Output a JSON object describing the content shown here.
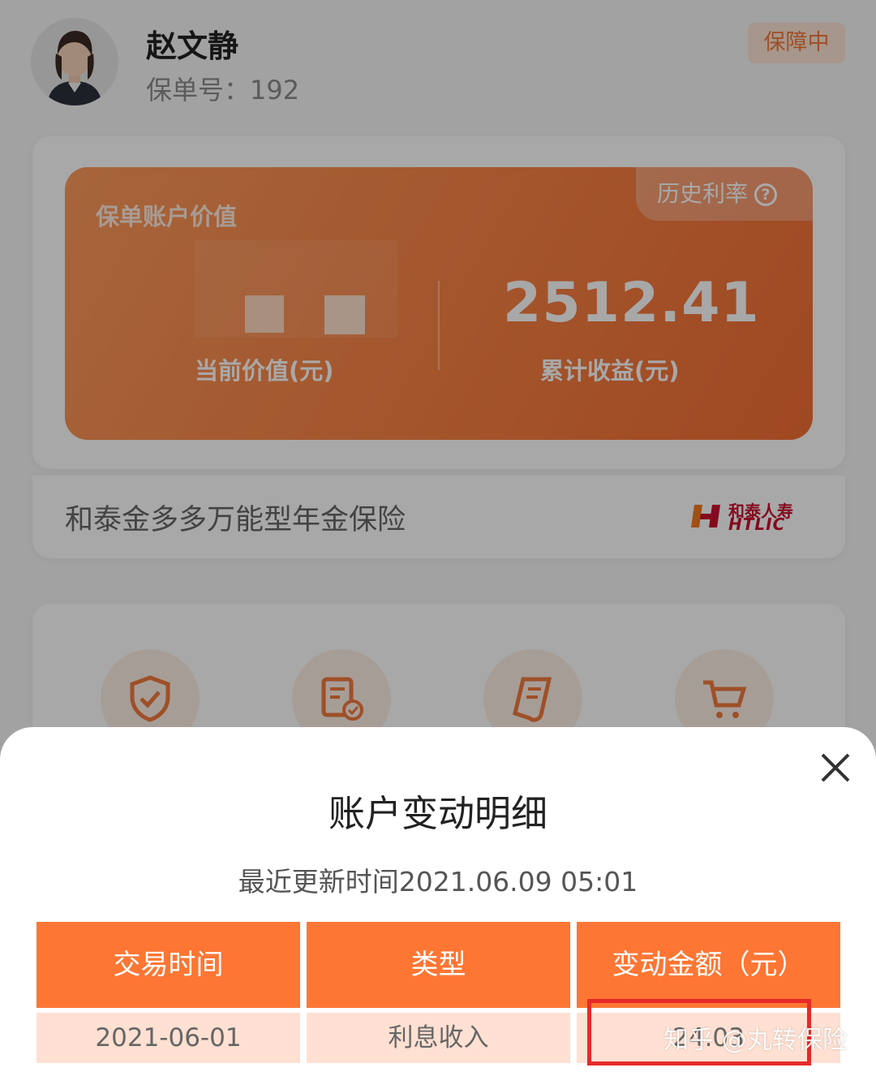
{
  "user": {
    "name": "赵文静",
    "policy_label": "保单号：192",
    "status": "保障中"
  },
  "account_panel": {
    "title": "保单账户价值",
    "history_rate": "历史利率",
    "current_value_label": "当前价值(元)",
    "total_earnings": "2512.41",
    "total_earnings_label": "累计收益(元)"
  },
  "product": {
    "name": "和泰金多多万能型年金保险",
    "company_cn": "和泰人寿",
    "company_en": "HTLIC"
  },
  "sheet": {
    "title": "账户变动明细",
    "update_time": "最近更新时间2021.06.09 05:01",
    "columns": [
      "交易时间",
      "类型",
      "变动金额（元）"
    ],
    "rows": [
      {
        "date": "2021-06-01",
        "type": "利息收入",
        "amount": "24.03"
      }
    ]
  },
  "watermark": "知乎 @丸转保险",
  "colors": {
    "accent": "#fd7634",
    "highlight": "#e72a2a",
    "row_bg": "#ffe0d2"
  }
}
